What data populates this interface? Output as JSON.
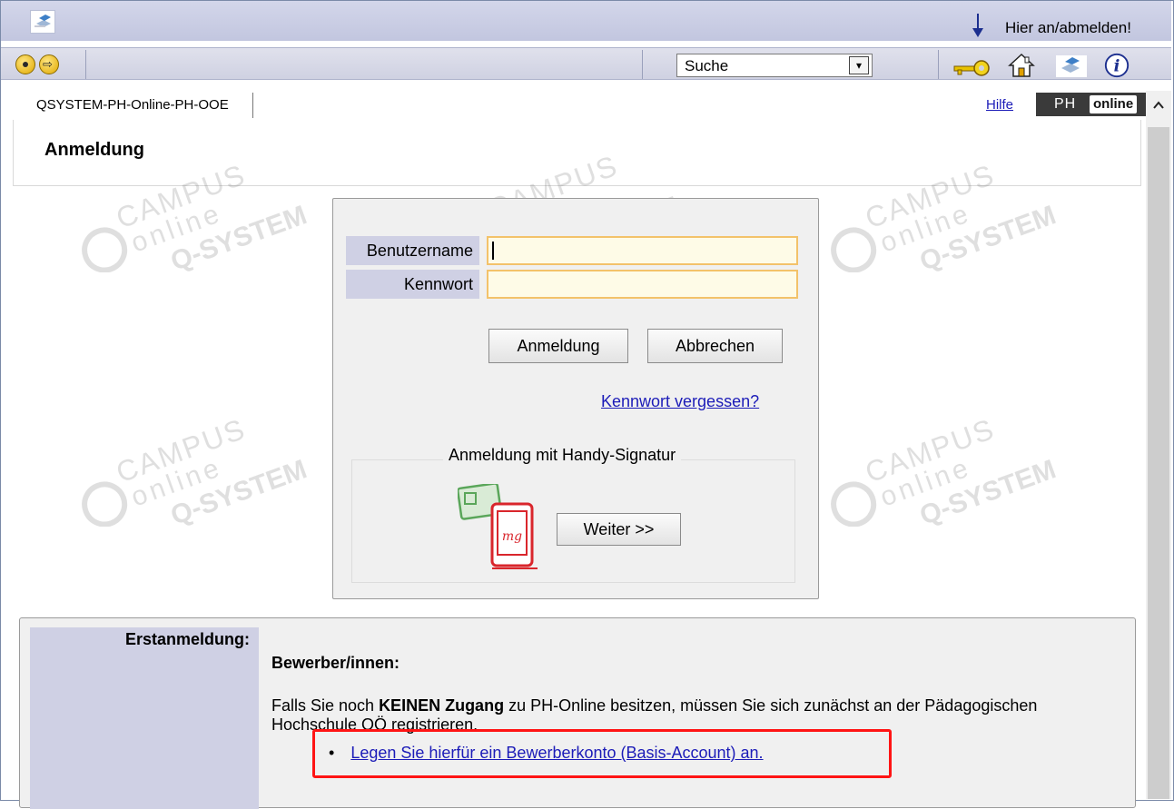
{
  "header": {
    "login_hint": "Hier an/abmelden!"
  },
  "toolbar": {
    "search_value": "Suche"
  },
  "content": {
    "breadcrumb": "QSYSTEM-PH-Online-PH-OOE",
    "help_link": "Hilfe",
    "badge_ph": "PH",
    "badge_online": "online",
    "page_title": "Anmeldung"
  },
  "login": {
    "username_label": "Benutzername",
    "username_value": "",
    "password_label": "Kennwort",
    "password_value": "",
    "submit_label": "Anmeldung",
    "cancel_label": "Abbrechen",
    "forgot_link": "Kennwort vergessen?",
    "handy_legend": "Anmeldung mit Handy-Signatur",
    "handy_button": "Weiter >>"
  },
  "first_login": {
    "label": "Erstanmeldung:",
    "title": "Bewerber/innen:",
    "text_before": "Falls Sie noch ",
    "text_bold": "KEINEN Zugang",
    "text_after": " zu PH-Online besitzen, müssen Sie sich zunächst an der Pädagogischen Hochschule OÖ registrieren.",
    "bullet": "•",
    "link": "Legen Sie hierfür ein Bewerberkonto (Basis-Account) an."
  },
  "watermark": {
    "line1": "CAMPUS",
    "line2": "online",
    "line3": "Q-SYSTEM"
  },
  "colors": {
    "accent_label_bg": "#cfd0e4",
    "link": "#1c1cb8",
    "highlight": "#ff1414",
    "input_border": "#f3c26a"
  },
  "icons": [
    "app-logo-icon",
    "down-arrow-icon",
    "record-icon",
    "forward-arrow-icon",
    "key-icon",
    "home-icon",
    "app-icon",
    "info-icon",
    "scroll-up-icon",
    "handy-signatur-icon"
  ]
}
